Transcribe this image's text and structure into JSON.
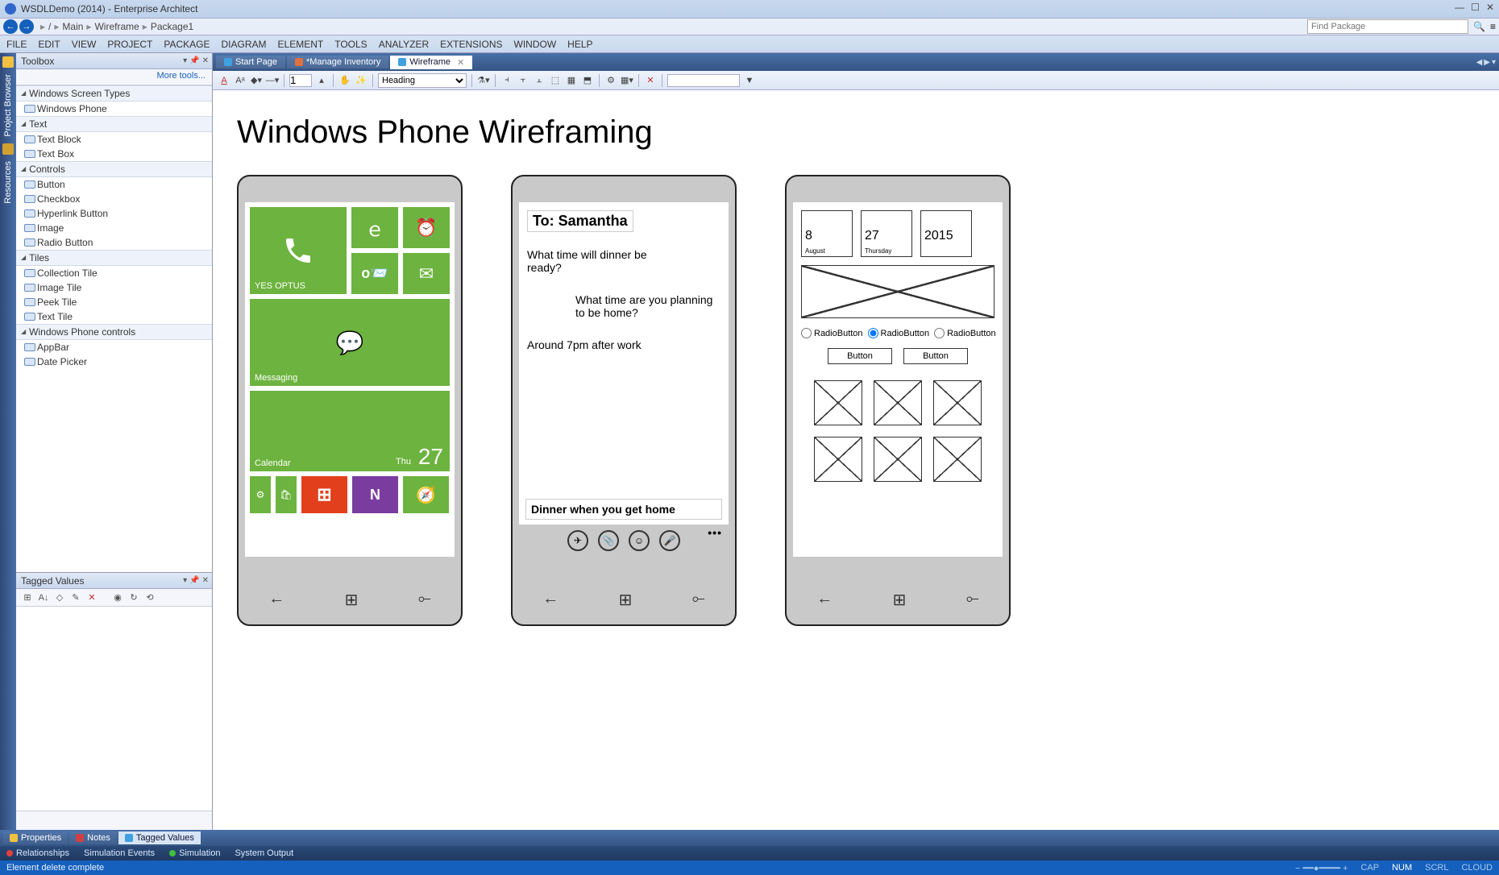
{
  "title": "WSDLDemo (2014) - Enterprise Architect",
  "breadcrumb": [
    "Main",
    "Wireframe",
    "Package1"
  ],
  "find_placeholder": "Find Package",
  "menu": [
    "FILE",
    "EDIT",
    "VIEW",
    "PROJECT",
    "PACKAGE",
    "DIAGRAM",
    "ELEMENT",
    "TOOLS",
    "ANALYZER",
    "EXTENSIONS",
    "WINDOW",
    "HELP"
  ],
  "left_vertical_tabs": [
    "Project Browser",
    "Resources"
  ],
  "toolbox": {
    "title": "Toolbox",
    "more": "More tools...",
    "groups": [
      {
        "name": "Windows Screen Types",
        "items": [
          "Windows Phone"
        ]
      },
      {
        "name": "Text",
        "items": [
          "Text Block",
          "Text Box"
        ]
      },
      {
        "name": "Controls",
        "items": [
          "Button",
          "Checkbox",
          "Hyperlink Button",
          "Image",
          "Radio Button"
        ]
      },
      {
        "name": "Tiles",
        "items": [
          "Collection Tile",
          "Image Tile",
          "Peek Tile",
          "Text Tile"
        ]
      },
      {
        "name": "Windows Phone controls",
        "items": [
          "AppBar",
          "Date Picker"
        ]
      }
    ]
  },
  "tagged_values": {
    "title": "Tagged Values"
  },
  "bottom_tabs": [
    "Properties",
    "Notes",
    "Tagged Values"
  ],
  "bottom_tabs2": [
    "Relationships",
    "Simulation Events",
    "Simulation",
    "System Output"
  ],
  "status": {
    "left": "Element delete complete",
    "caps": "CAP",
    "num": "NUM",
    "scrl": "SCRL",
    "cloud": "CLOUD"
  },
  "doc_tabs": [
    {
      "label": "Start Page",
      "active": false
    },
    {
      "label": "*Manage Inventory",
      "active": false
    },
    {
      "label": "Wireframe",
      "active": true
    }
  ],
  "diagram_toolbar": {
    "heading": "Heading",
    "page": "1"
  },
  "canvas": {
    "title": "Windows Phone Wireframing",
    "phone1": {
      "yes_optus": "YES OPTUS",
      "messaging": "Messaging",
      "calendar": "Calendar",
      "cal_day": "Thu",
      "cal_num": "27"
    },
    "phone2": {
      "to": "To: Samantha",
      "msg1": "What time will dinner be ready?",
      "msg2": "What time are you planning to be home?",
      "msg3": "Around 7pm after work",
      "input": "Dinner when you get home"
    },
    "phone3": {
      "day": "8",
      "day_sub": "August",
      "wday": "27",
      "wday_sub": "Thursday",
      "year": "2015",
      "radio": "RadioButton",
      "button": "Button"
    }
  }
}
